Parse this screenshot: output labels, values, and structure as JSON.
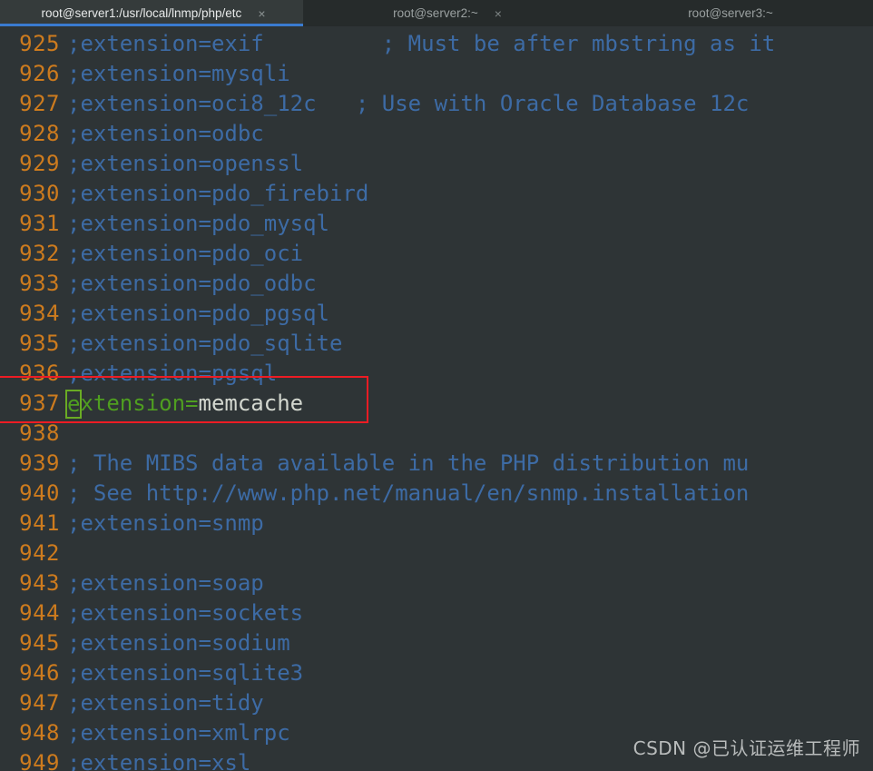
{
  "window": {
    "app": "terminal-ssh-client",
    "background_color": "#2e3436"
  },
  "tabbar": {
    "active_underline_color": "#3a7bd0",
    "close_icon": "×",
    "tabs": [
      {
        "label": "root@server1:/usr/local/lnmp/php/etc",
        "active": true,
        "closable": true
      },
      {
        "label": "root@server2:~",
        "active": false,
        "closable": true
      },
      {
        "label": "root@server3:~",
        "active": false,
        "closable": false
      }
    ]
  },
  "editor": {
    "line_number_color": "#cd7b1e",
    "comment_color": "#3d6ba5",
    "active_code_color": "#4f9e20",
    "value_color": "#d3d7cf",
    "cursor_color": "#6aab24",
    "lines": [
      {
        "no": "925",
        "text": ";extension=exif         ; Must be after mbstring as it"
      },
      {
        "no": "926",
        "text": ";extension=mysqli"
      },
      {
        "no": "927",
        "text": ";extension=oci8_12c   ; Use with Oracle Database 12c"
      },
      {
        "no": "928",
        "text": ";extension=odbc"
      },
      {
        "no": "929",
        "text": ";extension=openssl"
      },
      {
        "no": "930",
        "text": ";extension=pdo_firebird"
      },
      {
        "no": "931",
        "text": ";extension=pdo_mysql"
      },
      {
        "no": "932",
        "text": ";extension=pdo_oci"
      },
      {
        "no": "933",
        "text": ";extension=pdo_odbc"
      },
      {
        "no": "934",
        "text": ";extension=pdo_pgsql"
      },
      {
        "no": "935",
        "text": ";extension=pdo_sqlite"
      },
      {
        "no": "936",
        "text": ";extension=pgsql"
      },
      {
        "no": "937",
        "text": "extension=memcache",
        "active": true,
        "cursor_char": "e",
        "head": "xtension=",
        "tail": "memcache"
      },
      {
        "no": "938",
        "text": ""
      },
      {
        "no": "939",
        "text": "; The MIBS data available in the PHP distribution mu"
      },
      {
        "no": "940",
        "text": "; See http://www.php.net/manual/en/snmp.installation"
      },
      {
        "no": "941",
        "text": ";extension=snmp"
      },
      {
        "no": "942",
        "text": ""
      },
      {
        "no": "943",
        "text": ";extension=soap"
      },
      {
        "no": "944",
        "text": ";extension=sockets"
      },
      {
        "no": "945",
        "text": ";extension=sodium"
      },
      {
        "no": "946",
        "text": ";extension=sqlite3"
      },
      {
        "no": "947",
        "text": ";extension=tidy"
      },
      {
        "no": "948",
        "text": ";extension=xmlrpc"
      },
      {
        "no": "949",
        "text": ";extension=xsl"
      }
    ]
  },
  "annotation": {
    "box_color": "#ed1c24",
    "target_line": "937"
  },
  "watermark": {
    "text": "CSDN @已认证运维工程师"
  }
}
